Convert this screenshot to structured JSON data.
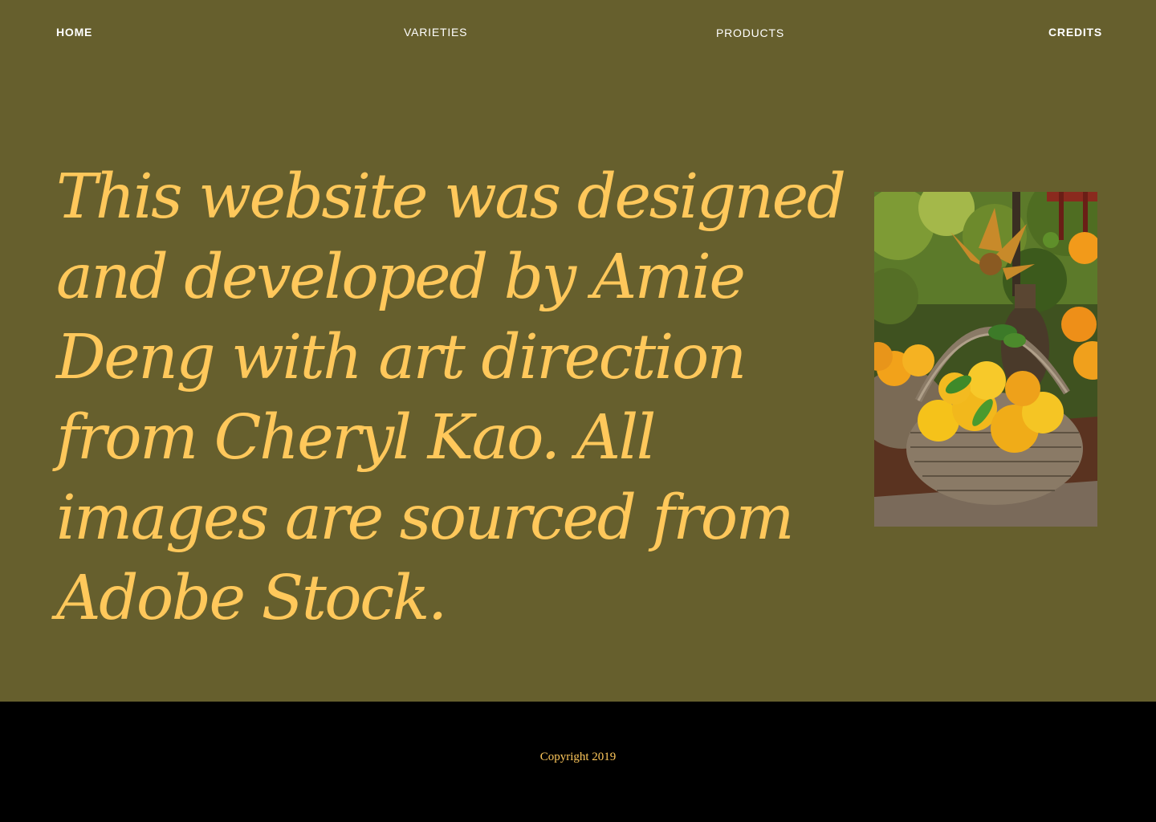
{
  "nav": {
    "home": "HOME",
    "varieties": "VARIETIES",
    "products": "PRODUCTS",
    "credits": "CREDITS"
  },
  "hero": {
    "text": "This website was designed and developed by Amie Deng with art direction from Cheryl Kao. All images are sourced from Adobe Stock."
  },
  "photo": {
    "subject": "wicker baskets of oranges and lemons"
  },
  "footer": {
    "copyright": "Copyright 2019"
  },
  "colors": {
    "background": "#665f2d",
    "accent": "#ffc85b",
    "footer": "#000000",
    "nav_text": "#ffffff"
  }
}
